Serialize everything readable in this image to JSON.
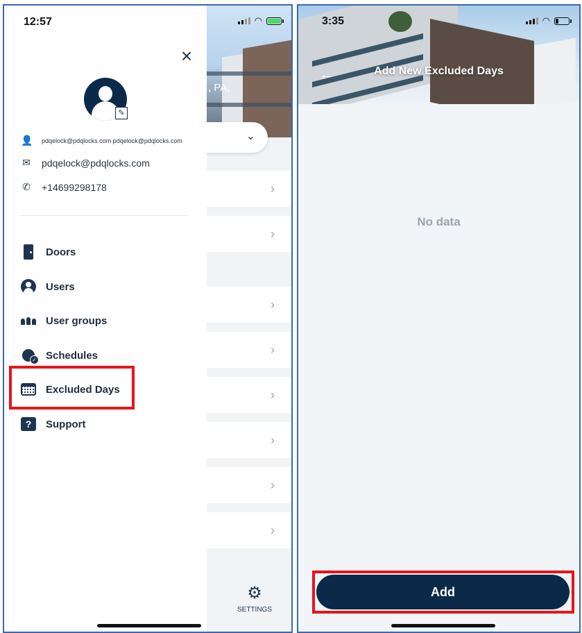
{
  "left_screen": {
    "status_time": "12:57",
    "close_icon": "×",
    "user_info": {
      "username": "pdqelock@pdqlocks.com pdqelock@pdqlocks.com",
      "email": "pdqelock@pdqlocks.com",
      "phone": "+14699298178"
    },
    "menu": [
      {
        "label": "Doors",
        "icon": "door-icon"
      },
      {
        "label": "Users",
        "icon": "user-circle-icon"
      },
      {
        "label": "User groups",
        "icon": "user-group-icon"
      },
      {
        "label": "Schedules",
        "icon": "schedule-clock-icon"
      },
      {
        "label": "Excluded Days",
        "icon": "calendar-icon",
        "highlighted": true
      },
      {
        "label": "Support",
        "icon": "support-question-icon"
      }
    ],
    "background_app": {
      "hero_text": ", PA,",
      "settings_label": "SETTINGS",
      "chevron": "›",
      "dropdown_chevron": "⌄"
    },
    "highlight_color": "#e8131a"
  },
  "right_screen": {
    "status_time": "3:35",
    "title": "Add New Excluded Days",
    "back_icon": "←",
    "empty_text": "No data",
    "add_button_label": "Add",
    "button_color": "#0b2a4a"
  },
  "frame_border_color": "#3a67b3"
}
